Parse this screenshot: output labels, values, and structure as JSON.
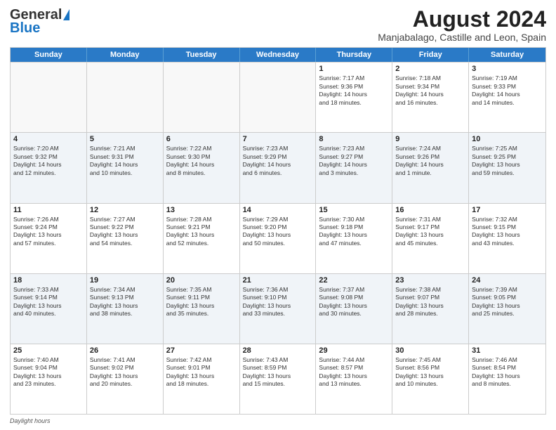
{
  "header": {
    "logo_line1": "General",
    "logo_line2": "Blue",
    "title": "August 2024",
    "subtitle": "Manjabalago, Castille and Leon, Spain"
  },
  "calendar": {
    "days_of_week": [
      "Sunday",
      "Monday",
      "Tuesday",
      "Wednesday",
      "Thursday",
      "Friday",
      "Saturday"
    ],
    "weeks": [
      [
        {
          "day": "",
          "info": "",
          "empty": true
        },
        {
          "day": "",
          "info": "",
          "empty": true
        },
        {
          "day": "",
          "info": "",
          "empty": true
        },
        {
          "day": "",
          "info": "",
          "empty": true
        },
        {
          "day": "1",
          "info": "Sunrise: 7:17 AM\nSunset: 9:36 PM\nDaylight: 14 hours\nand 18 minutes."
        },
        {
          "day": "2",
          "info": "Sunrise: 7:18 AM\nSunset: 9:34 PM\nDaylight: 14 hours\nand 16 minutes."
        },
        {
          "day": "3",
          "info": "Sunrise: 7:19 AM\nSunset: 9:33 PM\nDaylight: 14 hours\nand 14 minutes."
        }
      ],
      [
        {
          "day": "4",
          "info": "Sunrise: 7:20 AM\nSunset: 9:32 PM\nDaylight: 14 hours\nand 12 minutes."
        },
        {
          "day": "5",
          "info": "Sunrise: 7:21 AM\nSunset: 9:31 PM\nDaylight: 14 hours\nand 10 minutes."
        },
        {
          "day": "6",
          "info": "Sunrise: 7:22 AM\nSunset: 9:30 PM\nDaylight: 14 hours\nand 8 minutes."
        },
        {
          "day": "7",
          "info": "Sunrise: 7:23 AM\nSunset: 9:29 PM\nDaylight: 14 hours\nand 6 minutes."
        },
        {
          "day": "8",
          "info": "Sunrise: 7:23 AM\nSunset: 9:27 PM\nDaylight: 14 hours\nand 3 minutes."
        },
        {
          "day": "9",
          "info": "Sunrise: 7:24 AM\nSunset: 9:26 PM\nDaylight: 14 hours\nand 1 minute."
        },
        {
          "day": "10",
          "info": "Sunrise: 7:25 AM\nSunset: 9:25 PM\nDaylight: 13 hours\nand 59 minutes."
        }
      ],
      [
        {
          "day": "11",
          "info": "Sunrise: 7:26 AM\nSunset: 9:24 PM\nDaylight: 13 hours\nand 57 minutes."
        },
        {
          "day": "12",
          "info": "Sunrise: 7:27 AM\nSunset: 9:22 PM\nDaylight: 13 hours\nand 54 minutes."
        },
        {
          "day": "13",
          "info": "Sunrise: 7:28 AM\nSunset: 9:21 PM\nDaylight: 13 hours\nand 52 minutes."
        },
        {
          "day": "14",
          "info": "Sunrise: 7:29 AM\nSunset: 9:20 PM\nDaylight: 13 hours\nand 50 minutes."
        },
        {
          "day": "15",
          "info": "Sunrise: 7:30 AM\nSunset: 9:18 PM\nDaylight: 13 hours\nand 47 minutes."
        },
        {
          "day": "16",
          "info": "Sunrise: 7:31 AM\nSunset: 9:17 PM\nDaylight: 13 hours\nand 45 minutes."
        },
        {
          "day": "17",
          "info": "Sunrise: 7:32 AM\nSunset: 9:15 PM\nDaylight: 13 hours\nand 43 minutes."
        }
      ],
      [
        {
          "day": "18",
          "info": "Sunrise: 7:33 AM\nSunset: 9:14 PM\nDaylight: 13 hours\nand 40 minutes."
        },
        {
          "day": "19",
          "info": "Sunrise: 7:34 AM\nSunset: 9:13 PM\nDaylight: 13 hours\nand 38 minutes."
        },
        {
          "day": "20",
          "info": "Sunrise: 7:35 AM\nSunset: 9:11 PM\nDaylight: 13 hours\nand 35 minutes."
        },
        {
          "day": "21",
          "info": "Sunrise: 7:36 AM\nSunset: 9:10 PM\nDaylight: 13 hours\nand 33 minutes."
        },
        {
          "day": "22",
          "info": "Sunrise: 7:37 AM\nSunset: 9:08 PM\nDaylight: 13 hours\nand 30 minutes."
        },
        {
          "day": "23",
          "info": "Sunrise: 7:38 AM\nSunset: 9:07 PM\nDaylight: 13 hours\nand 28 minutes."
        },
        {
          "day": "24",
          "info": "Sunrise: 7:39 AM\nSunset: 9:05 PM\nDaylight: 13 hours\nand 25 minutes."
        }
      ],
      [
        {
          "day": "25",
          "info": "Sunrise: 7:40 AM\nSunset: 9:04 PM\nDaylight: 13 hours\nand 23 minutes."
        },
        {
          "day": "26",
          "info": "Sunrise: 7:41 AM\nSunset: 9:02 PM\nDaylight: 13 hours\nand 20 minutes."
        },
        {
          "day": "27",
          "info": "Sunrise: 7:42 AM\nSunset: 9:01 PM\nDaylight: 13 hours\nand 18 minutes."
        },
        {
          "day": "28",
          "info": "Sunrise: 7:43 AM\nSunset: 8:59 PM\nDaylight: 13 hours\nand 15 minutes."
        },
        {
          "day": "29",
          "info": "Sunrise: 7:44 AM\nSunset: 8:57 PM\nDaylight: 13 hours\nand 13 minutes."
        },
        {
          "day": "30",
          "info": "Sunrise: 7:45 AM\nSunset: 8:56 PM\nDaylight: 13 hours\nand 10 minutes."
        },
        {
          "day": "31",
          "info": "Sunrise: 7:46 AM\nSunset: 8:54 PM\nDaylight: 13 hours\nand 8 minutes."
        }
      ]
    ]
  },
  "footer": {
    "label": "Daylight hours"
  }
}
